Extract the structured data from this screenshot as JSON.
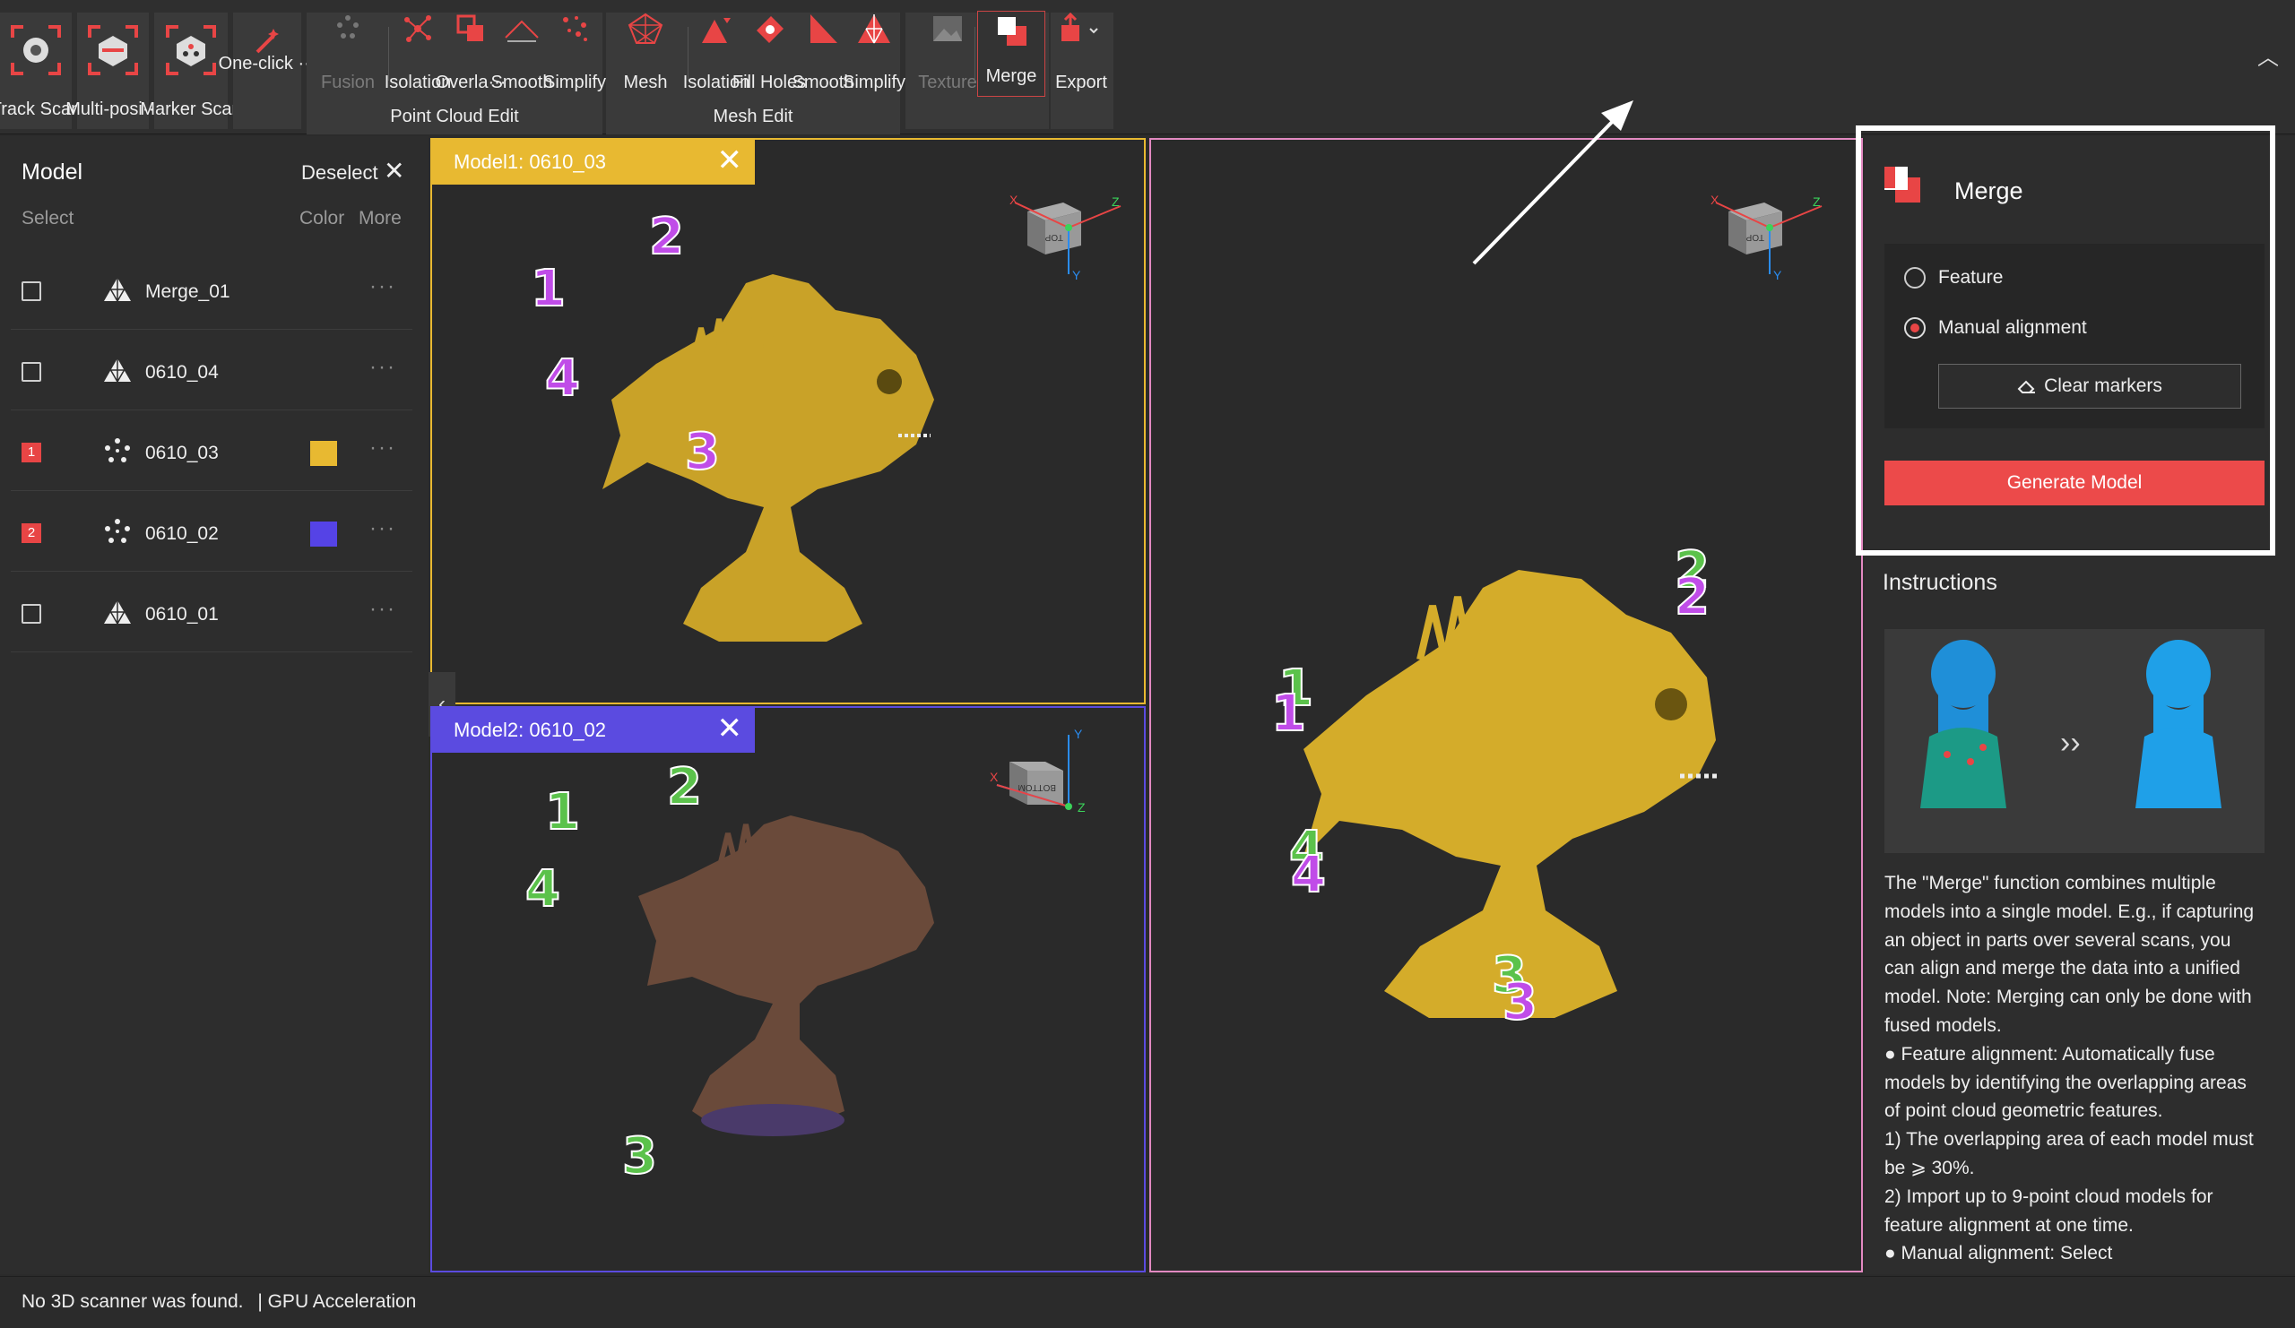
{
  "toolbar": {
    "track_scan": "Track Scan",
    "multi_pos": "Multi-posi···",
    "marker_scan": "Marker Scan",
    "one_click": "One-click ···",
    "fusion": "Fusion",
    "pc_isolation": "Isolation",
    "pc_overlap": "Overla···",
    "pc_smooth": "Smooth",
    "pc_simplify": "Simplify",
    "point_cloud_edit": "Point Cloud Edit",
    "mesh": "Mesh",
    "mesh_isolation": "Isolation",
    "fill_holes": "Fill Holes",
    "mesh_smooth": "Smooth",
    "mesh_simplify": "Simplify",
    "mesh_edit": "Mesh Edit",
    "texture": "Texture",
    "merge": "Merge",
    "export": "Export"
  },
  "model_panel": {
    "title": "Model",
    "deselect": "Deselect",
    "col_select": "Select",
    "col_color": "Color",
    "col_more": "More",
    "rows": [
      {
        "name": "Merge_01",
        "type": "mesh",
        "marker": "",
        "color": ""
      },
      {
        "name": "0610_04",
        "type": "mesh",
        "marker": "",
        "color": ""
      },
      {
        "name": "0610_03",
        "type": "point-cloud",
        "marker": "1",
        "color": "#e8b931"
      },
      {
        "name": "0610_02",
        "type": "point-cloud",
        "marker": "2",
        "color": "#5543e6"
      },
      {
        "name": "0610_01",
        "type": "mesh",
        "marker": "",
        "color": ""
      }
    ]
  },
  "viewports": {
    "model1_title": "Model1: 0610_03",
    "model2_title": "Model2: 0610_02",
    "model1_color": "#e8b931",
    "model2_color": "#5b4be0",
    "merged_border_color": "#e289c1",
    "cube_top": "TOP",
    "cube_bottom": "BOTTOM",
    "axis_x": "X",
    "axis_y": "Y",
    "axis_z": "Z"
  },
  "points": {
    "p1": "1",
    "p2": "2",
    "p3": "3",
    "p4": "4"
  },
  "merge_panel": {
    "title": "Merge",
    "option_feature": "Feature",
    "option_manual": "Manual alignment",
    "selected_option": "Manual alignment",
    "clear_markers": "Clear markers",
    "generate": "Generate Model",
    "instructions_title": "Instructions",
    "instructions": [
      "The \"Merge\" function combines multiple models into a single model. E.g., if capturing an object in parts over several scans, you can align and merge the data into a unified model. Note: Merging can only be done with fused models.",
      "● Feature alignment: Automatically fuse models by identifying the overlapping areas of point cloud geometric features.",
      "1) The overlapping area of each model must be ⩾ 30%.",
      "2) Import up to 9-point cloud models for feature alignment at one time.",
      "● Manual alignment: Select"
    ]
  },
  "status_bar": {
    "text": "No 3D scanner was found.",
    "gpu": "| GPU Acceleration"
  }
}
